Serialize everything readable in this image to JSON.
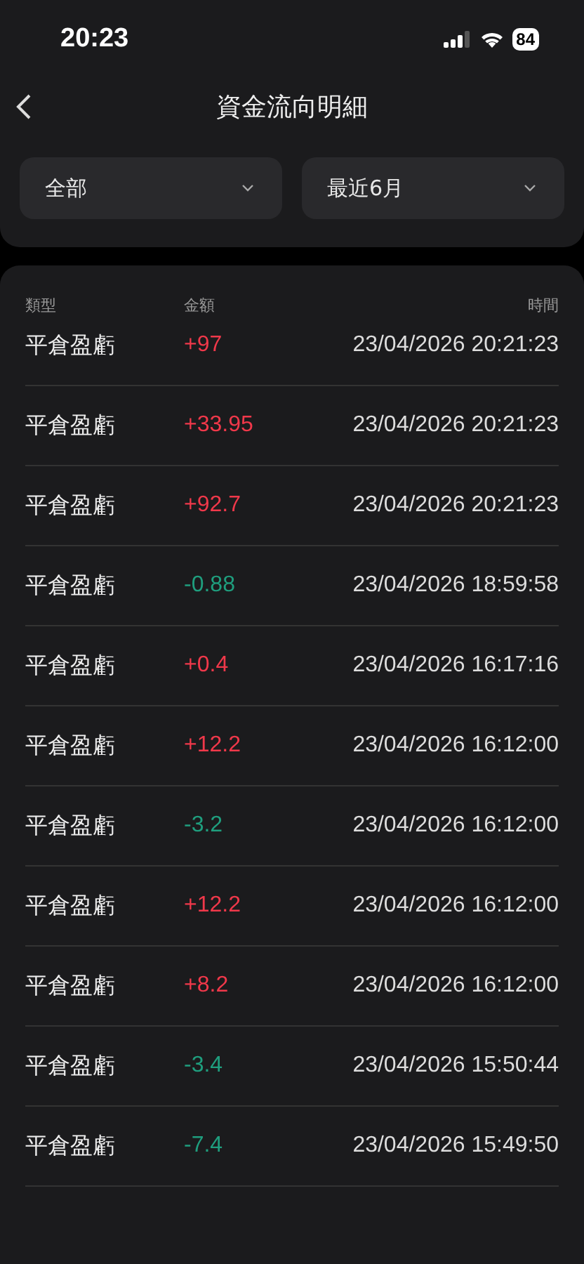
{
  "status_bar": {
    "time": "20:23",
    "battery": "84"
  },
  "header": {
    "title": "資金流向明細"
  },
  "filters": [
    {
      "label": "全部"
    },
    {
      "label": "最近6月"
    }
  ],
  "table": {
    "columns": [
      "類型",
      "金額",
      "時間"
    ],
    "rows": [
      {
        "type": "平倉盈虧",
        "amount": "+97",
        "kind": "gain",
        "time": "23/04/2026 20:21:23"
      },
      {
        "type": "平倉盈虧",
        "amount": "+33.95",
        "kind": "gain",
        "time": "23/04/2026 20:21:23"
      },
      {
        "type": "平倉盈虧",
        "amount": "+92.7",
        "kind": "gain",
        "time": "23/04/2026 20:21:23"
      },
      {
        "type": "平倉盈虧",
        "amount": "-0.88",
        "kind": "loss",
        "time": "23/04/2026 18:59:58"
      },
      {
        "type": "平倉盈虧",
        "amount": "+0.4",
        "kind": "gain",
        "time": "23/04/2026 16:17:16"
      },
      {
        "type": "平倉盈虧",
        "amount": "+12.2",
        "kind": "gain",
        "time": "23/04/2026 16:12:00"
      },
      {
        "type": "平倉盈虧",
        "amount": "-3.2",
        "kind": "loss",
        "time": "23/04/2026 16:12:00"
      },
      {
        "type": "平倉盈虧",
        "amount": "+12.2",
        "kind": "gain",
        "time": "23/04/2026 16:12:00"
      },
      {
        "type": "平倉盈虧",
        "amount": "+8.2",
        "kind": "gain",
        "time": "23/04/2026 16:12:00"
      },
      {
        "type": "平倉盈虧",
        "amount": "-3.4",
        "kind": "loss",
        "time": "23/04/2026 15:50:44"
      },
      {
        "type": "平倉盈虧",
        "amount": "-7.4",
        "kind": "loss",
        "time": "23/04/2026 15:49:50"
      }
    ]
  }
}
